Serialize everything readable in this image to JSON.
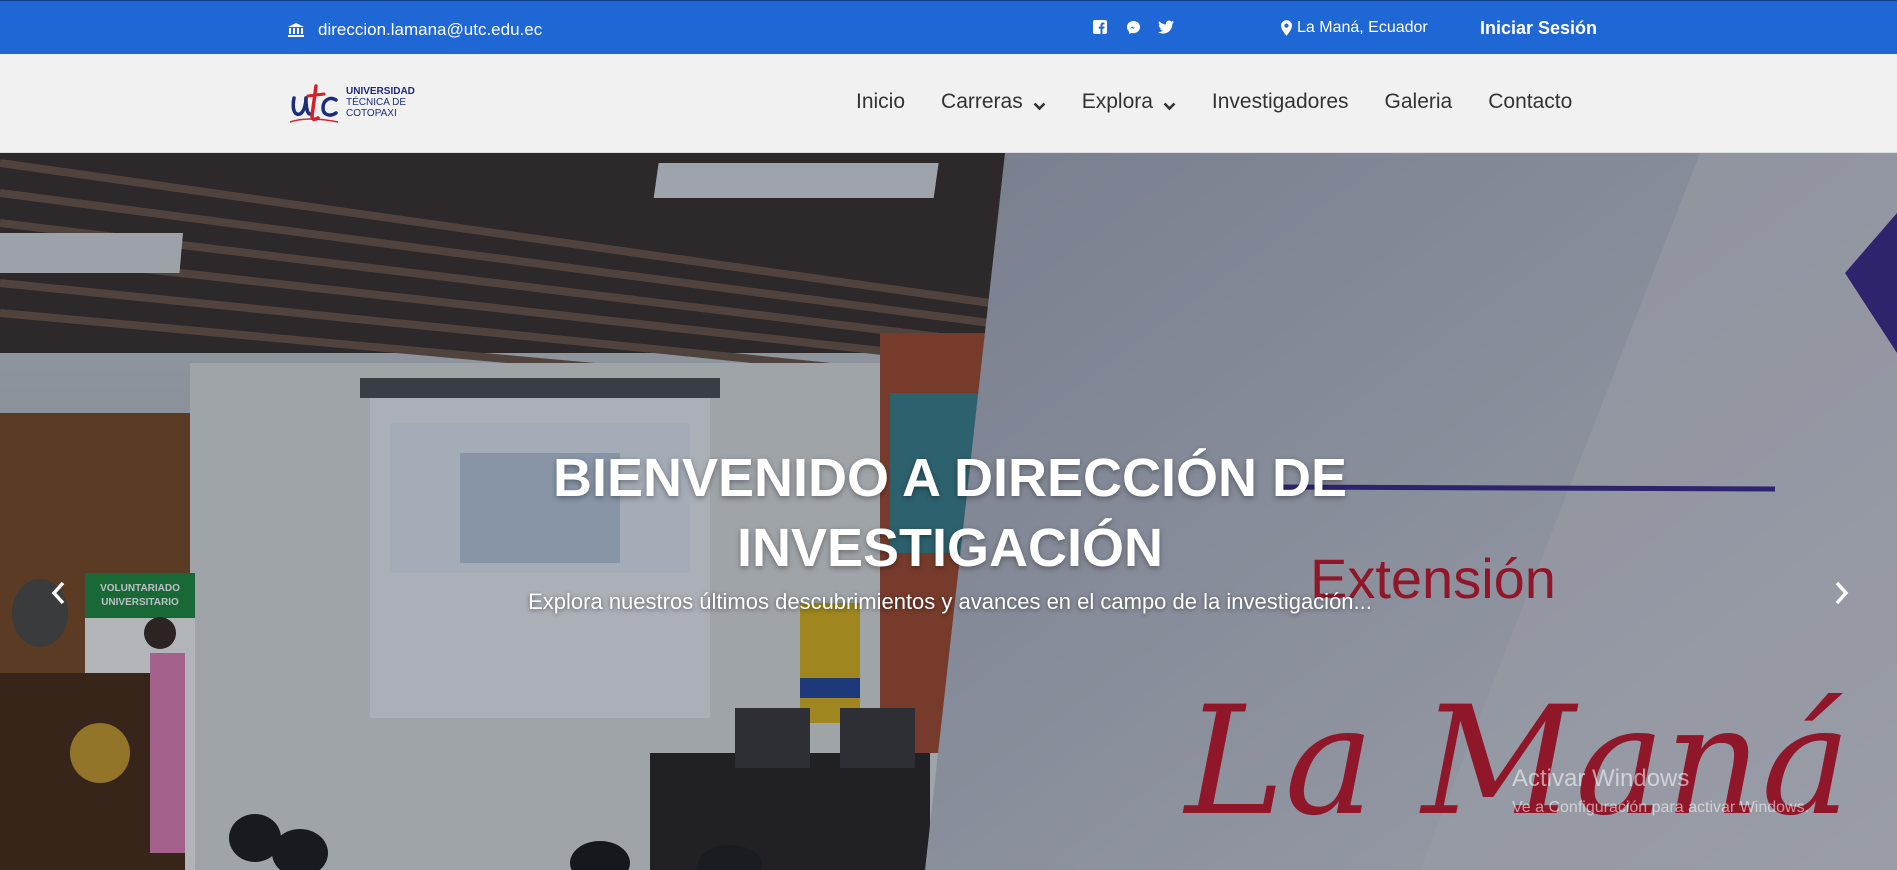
{
  "topbar": {
    "email": "direccion.lamana@utc.edu.ec",
    "social_icons": [
      "facebook-icon",
      "messenger-icon",
      "twitter-icon"
    ],
    "location": "La Maná, Ecuador",
    "login_label": "Iniciar Sesión",
    "background_color": "#1e67d4"
  },
  "logo": {
    "line1": "UNIVERSIDAD",
    "line2": "TÉCNICA DE",
    "line3": "COTOPAXI",
    "mark": "utc"
  },
  "nav": {
    "items": [
      {
        "label": "Inicio",
        "has_dropdown": false
      },
      {
        "label": "Carreras",
        "has_dropdown": true
      },
      {
        "label": "Explora",
        "has_dropdown": true
      },
      {
        "label": "Investigadores",
        "has_dropdown": false
      },
      {
        "label": "Galeria",
        "has_dropdown": false
      },
      {
        "label": "Contacto",
        "has_dropdown": false
      }
    ]
  },
  "hero": {
    "title": "BIENVENIDO A DIRECCIÓN DE INVESTIGACIÓN",
    "subtitle": "Explora nuestros últimos descubrimientos y avances en el campo de la investigación...",
    "image_text_1": "Extensión",
    "image_text_2": "La Maná",
    "banner_1": "VOLUNTARIADO",
    "banner_2": "UNIVERSITARIO"
  },
  "watermark": {
    "line1": "Activar Windows",
    "line2": "Ve a Configuración para activar Windows."
  }
}
